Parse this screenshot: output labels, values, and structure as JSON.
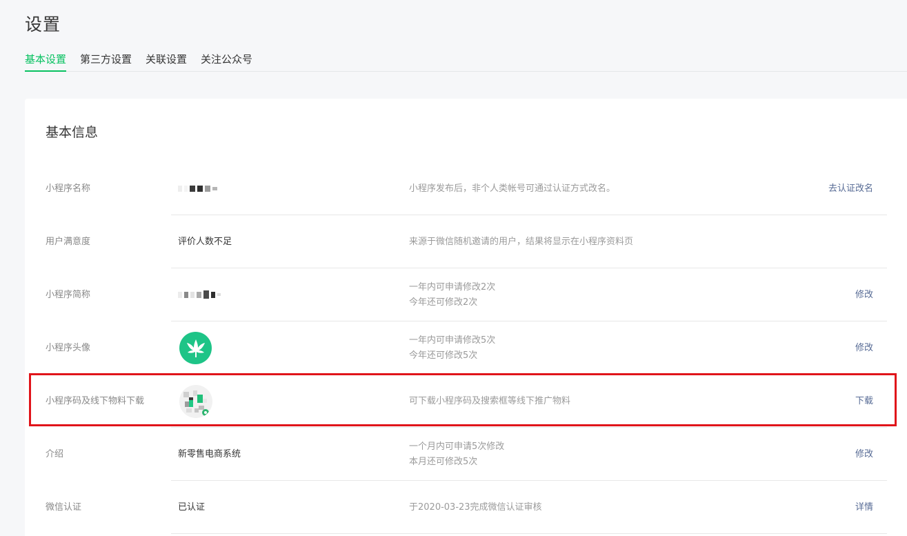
{
  "page": {
    "title": "设置"
  },
  "tabs": [
    {
      "label": "基本设置",
      "active": true
    },
    {
      "label": "第三方设置",
      "active": false
    },
    {
      "label": "关联设置",
      "active": false
    },
    {
      "label": "关注公众号",
      "active": false
    }
  ],
  "section": {
    "title": "基本信息"
  },
  "rows": [
    {
      "label": "小程序名称",
      "value": "",
      "desc1": "小程序发布后，非个人类帐号可通过认证方式改名。",
      "desc2": "",
      "action": "去认证改名"
    },
    {
      "label": "用户满意度",
      "value": "评价人数不足",
      "desc1": "来源于微信随机邀请的用户，结果将显示在小程序资料页",
      "desc2": "",
      "action": ""
    },
    {
      "label": "小程序简称",
      "value": "",
      "desc1": "一年内可申请修改2次",
      "desc2": "今年还可修改2次",
      "action": "修改"
    },
    {
      "label": "小程序头像",
      "value": "",
      "desc1": "一年内可申请修改5次",
      "desc2": "今年还可修改5次",
      "action": "修改"
    },
    {
      "label": "小程序码及线下物料下载",
      "value": "",
      "desc1": "可下载小程序码及搜索框等线下推广物料",
      "desc2": "",
      "action": "下载"
    },
    {
      "label": "介绍",
      "value": "新零售电商系统",
      "desc1": "一个月内可申请5次修改",
      "desc2": "本月还可修改5次",
      "action": "修改"
    },
    {
      "label": "微信认证",
      "value": "已认证",
      "desc1": "于2020-03-23完成微信认证审核",
      "desc2": "",
      "action": "详情"
    }
  ],
  "colors": {
    "accent": "#07c160",
    "link": "#576b95",
    "highlight": "#e0141a",
    "avatar": "#1ec487"
  },
  "icons": {
    "avatar": "leaf-icon",
    "qrcode": "mini-program-code-icon"
  }
}
